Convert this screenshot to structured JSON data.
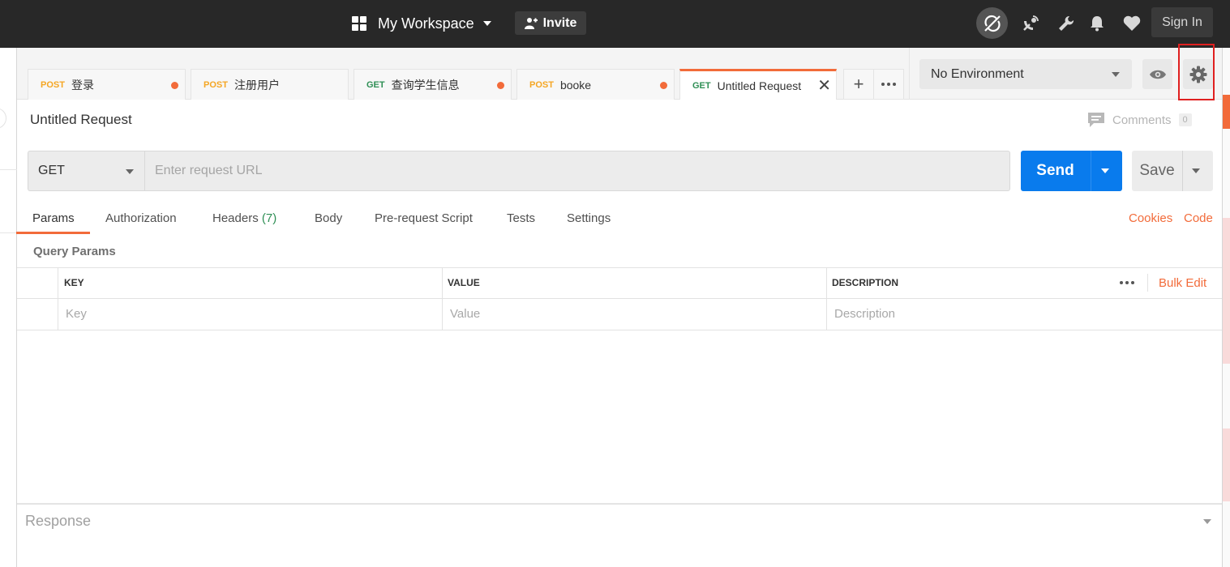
{
  "topbar": {
    "workspace_label": "My Workspace",
    "invite_label": "Invite",
    "signin_label": "Sign In",
    "icons": [
      "sync-off-icon",
      "satellite-icon",
      "wrench-icon",
      "bell-icon",
      "heart-icon"
    ]
  },
  "tabs": [
    {
      "method": "POST",
      "name": "登录",
      "unsaved": true
    },
    {
      "method": "POST",
      "name": "注册用户",
      "unsaved": false
    },
    {
      "method": "GET",
      "name": "查询学生信息",
      "unsaved": true
    },
    {
      "method": "POST",
      "name": "booke",
      "unsaved": true
    },
    {
      "method": "GET",
      "name": "Untitled Request",
      "active": true
    }
  ],
  "environment": {
    "selected": "No Environment"
  },
  "request": {
    "title": "Untitled Request",
    "comments_label": "Comments",
    "comments_count": "0",
    "method": "GET",
    "url_placeholder": "Enter request URL",
    "send_label": "Send",
    "save_label": "Save"
  },
  "request_tabs": {
    "params": "Params",
    "authorization": "Authorization",
    "headers": "Headers",
    "headers_count": "(7)",
    "body": "Body",
    "pre_request": "Pre-request Script",
    "tests": "Tests",
    "settings": "Settings",
    "cookies": "Cookies",
    "code": "Code"
  },
  "params": {
    "section_title": "Query Params",
    "columns": [
      "KEY",
      "VALUE",
      "DESCRIPTION"
    ],
    "placeholders": [
      "Key",
      "Value",
      "Description"
    ],
    "bulk_edit": "Bulk Edit"
  },
  "response": {
    "label": "Response"
  },
  "colors": {
    "accent": "#f26b3a",
    "send_blue": "#097bed",
    "post_method": "#f5a623",
    "get_method": "#2f8f55",
    "topbar": "#282828"
  }
}
